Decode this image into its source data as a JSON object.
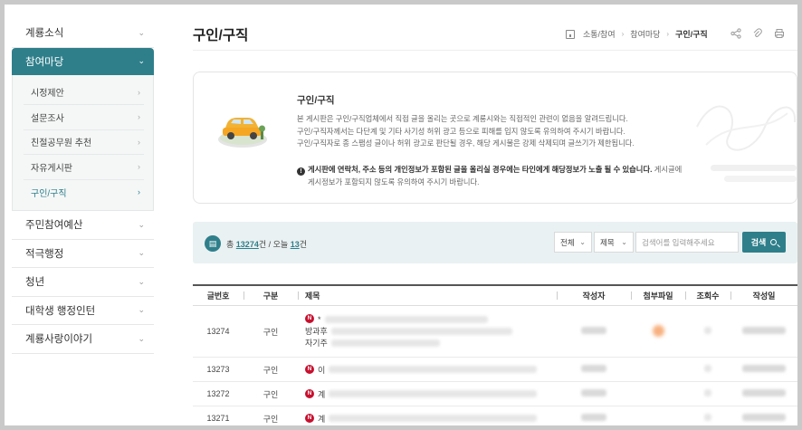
{
  "sidebar": {
    "top_item": {
      "label": "계룡소식"
    },
    "active_section": {
      "label": "참여마당",
      "items": [
        {
          "label": "시정제안"
        },
        {
          "label": "설문조사"
        },
        {
          "label": "친절공무원 추천"
        },
        {
          "label": "자유게시판"
        },
        {
          "label": "구인/구직"
        }
      ]
    },
    "items": [
      {
        "label": "주민참여예산"
      },
      {
        "label": "적극행정"
      },
      {
        "label": "청년"
      },
      {
        "label": "대학생 행정인턴"
      },
      {
        "label": "계룡사랑이야기"
      }
    ]
  },
  "header": {
    "title": "구인/구직",
    "breadcrumb": [
      "소통/참여",
      "참여마당",
      "구인/구직"
    ]
  },
  "info": {
    "title": "구인/구직",
    "lines": [
      "본 게시판은 구인/구직업체에서 직접 글을 올리는 곳으로 계룡시와는 직접적인 관련이 없음을 알려드립니다.",
      "구인/구직자께서는 다단계 및 기타 사기성 허위 광고 등으로 피해를 입지 않도록 유의하여 주시기 바랍니다.",
      "구인/구직자로 종 스팸성 글이나 허위 광고로 판단될 경우, 해당 게시물은 강제 삭제되며 글쓰기가 제한됩니다."
    ],
    "warning_bold": "게시판에 연락처, 주소 등의 개인정보가 포함된 글을 올리실 경우에는 타인에게 해당정보가 노출 될 수 있습니다.",
    "warning_rest": "게시글에",
    "warning_line2": "게시정보가 포함되지 않도록 유의하여 주시기 바랍니다."
  },
  "search": {
    "count_prefix": "총",
    "total": "13274",
    "total_unit": "건 / 오늘",
    "today": "13",
    "today_unit": "건",
    "scope_select": "전체",
    "field_select": "제목",
    "placeholder": "검색어를 입력해주세요",
    "button_label": "검색"
  },
  "table": {
    "headers": [
      "글번호",
      "구분",
      "제목",
      "작성자",
      "첨부파일",
      "조회수",
      "작성일"
    ],
    "rows": [
      {
        "no": "13274",
        "type": "구인",
        "title_lines": [
          "*",
          "방과후",
          "자기주"
        ],
        "has_attachment": true
      },
      {
        "no": "13273",
        "type": "구인",
        "title_lines": [
          "이"
        ],
        "has_attachment": false
      },
      {
        "no": "13272",
        "type": "구인",
        "title_lines": [
          "계"
        ],
        "has_attachment": false
      },
      {
        "no": "13271",
        "type": "구인",
        "title_lines": [
          "계"
        ],
        "has_attachment": false
      }
    ],
    "new_badge": "N"
  },
  "colors": {
    "accent": "#2f7f8b",
    "new_badge": "#c8102e",
    "search_bg": "#eaf1f2"
  }
}
